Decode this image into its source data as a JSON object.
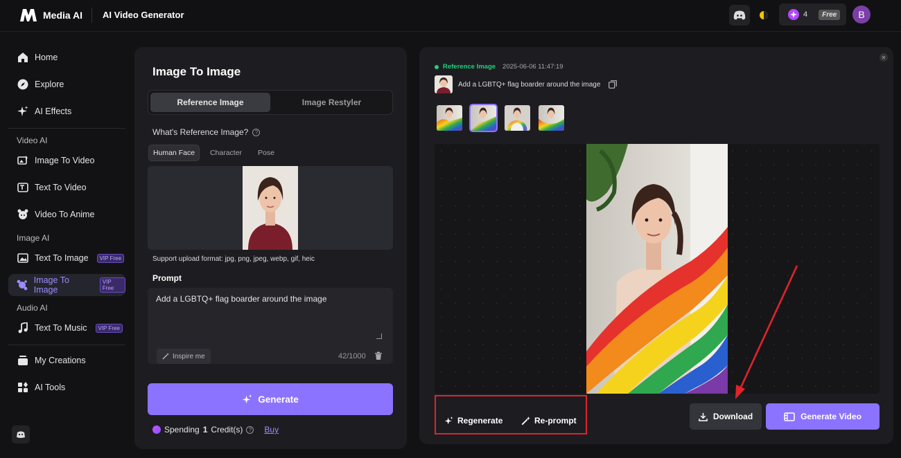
{
  "topbar": {
    "brand": "Media AI",
    "page_name": "AI Video Generator",
    "credits": "4",
    "plan_badge": "Free",
    "avatar_letter": "B"
  },
  "sidebar": {
    "items": [
      {
        "label": "Home",
        "icon": "home-icon"
      },
      {
        "label": "Explore",
        "icon": "compass-icon"
      },
      {
        "label": "AI Effects",
        "icon": "sparkle-icon"
      }
    ],
    "video_section": "Video AI",
    "video_items": [
      {
        "label": "Image To Video",
        "icon": "image-video-icon"
      },
      {
        "label": "Text To Video",
        "icon": "text-video-icon"
      },
      {
        "label": "Video To Anime",
        "icon": "anime-icon"
      }
    ],
    "image_section": "Image AI",
    "image_items": [
      {
        "label": "Text To Image",
        "badge": "VIP Free",
        "icon": "text-image-icon"
      },
      {
        "label": "Image To Image",
        "badge": "VIP Free",
        "icon": "image-image-icon",
        "active": true
      }
    ],
    "audio_section": "Audio AI",
    "audio_items": [
      {
        "label": "Text To Music",
        "badge": "VIP Free",
        "icon": "music-icon"
      }
    ],
    "bottom_items": [
      {
        "label": "My Creations",
        "icon": "creations-icon"
      },
      {
        "label": "AI Tools",
        "icon": "tools-icon"
      }
    ]
  },
  "left_panel": {
    "title": "Image To Image",
    "mode_tabs": [
      "Reference Image",
      "Image Restyler"
    ],
    "active_mode": "Reference Image",
    "question": "What's Reference Image?",
    "sub_tabs": [
      "Human Face",
      "Character",
      "Pose"
    ],
    "active_sub_tab": "Human Face",
    "format_note": "Support upload format: jpg, png, jpeg, webp, gif, heic",
    "prompt_label": "Prompt",
    "prompt_value": "Add a LGBTQ+ flag boarder around the image",
    "inspire_label": "Inspire me",
    "char_count": "42/1000",
    "generate_label": "Generate",
    "spending_prefix": "Spending",
    "spending_amount": "1",
    "spending_suffix": "Credit(s)",
    "buy_label": "Buy"
  },
  "right_panel": {
    "ref_label": "Reference Image",
    "timestamp": "2025-06-06 11:47:19",
    "prompt_text": "Add a LGBTQ+ flag boarder around the image",
    "regenerate_label": "Regenerate",
    "reprompt_label": "Re-prompt",
    "download_label": "Download",
    "generate_video_label": "Generate Video",
    "thumbnail_count": 4,
    "selected_thumbnail": 2
  },
  "colors": {
    "accent": "#8b73ff",
    "highlight": "#e0242a",
    "ref_green": "#22d07a"
  }
}
